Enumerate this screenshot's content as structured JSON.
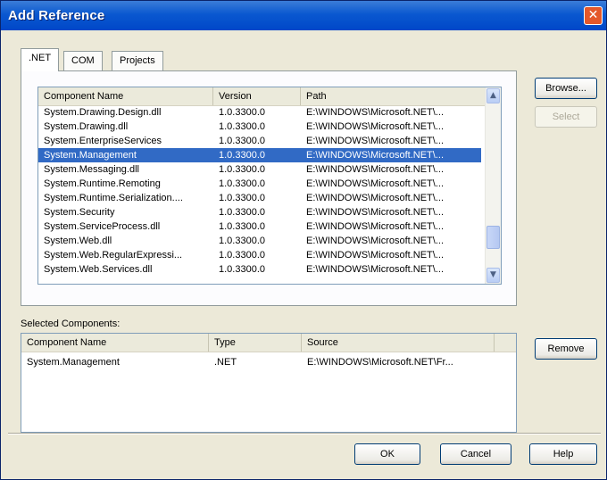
{
  "window": {
    "title": "Add Reference"
  },
  "tabs": [
    ".NET",
    "COM",
    "Projects"
  ],
  "components": {
    "columns": [
      "Component Name",
      "Version",
      "Path"
    ],
    "rows": [
      {
        "name": "System.Drawing.Design.dll",
        "version": "1.0.3300.0",
        "path": "E:\\WINDOWS\\Microsoft.NET\\..."
      },
      {
        "name": "System.Drawing.dll",
        "version": "1.0.3300.0",
        "path": "E:\\WINDOWS\\Microsoft.NET\\..."
      },
      {
        "name": "System.EnterpriseServices",
        "version": "1.0.3300.0",
        "path": "E:\\WINDOWS\\Microsoft.NET\\..."
      },
      {
        "name": "System.Management",
        "version": "1.0.3300.0",
        "path": "E:\\WINDOWS\\Microsoft.NET\\...",
        "selected": true
      },
      {
        "name": "System.Messaging.dll",
        "version": "1.0.3300.0",
        "path": "E:\\WINDOWS\\Microsoft.NET\\..."
      },
      {
        "name": "System.Runtime.Remoting",
        "version": "1.0.3300.0",
        "path": "E:\\WINDOWS\\Microsoft.NET\\..."
      },
      {
        "name": "System.Runtime.Serialization....",
        "version": "1.0.3300.0",
        "path": "E:\\WINDOWS\\Microsoft.NET\\..."
      },
      {
        "name": "System.Security",
        "version": "1.0.3300.0",
        "path": "E:\\WINDOWS\\Microsoft.NET\\..."
      },
      {
        "name": "System.ServiceProcess.dll",
        "version": "1.0.3300.0",
        "path": "E:\\WINDOWS\\Microsoft.NET\\..."
      },
      {
        "name": "System.Web.dll",
        "version": "1.0.3300.0",
        "path": "E:\\WINDOWS\\Microsoft.NET\\..."
      },
      {
        "name": "System.Web.RegularExpressi...",
        "version": "1.0.3300.0",
        "path": "E:\\WINDOWS\\Microsoft.NET\\..."
      },
      {
        "name": "System.Web.Services.dll",
        "version": "1.0.3300.0",
        "path": "E:\\WINDOWS\\Microsoft.NET\\..."
      }
    ]
  },
  "selected_label": "Selected Components:",
  "selected": {
    "columns": [
      "Component Name",
      "Type",
      "Source"
    ],
    "rows": [
      {
        "name": "System.Management",
        "type": ".NET",
        "source": "E:\\WINDOWS\\Microsoft.NET\\Fr..."
      }
    ]
  },
  "buttons": {
    "browse": "Browse...",
    "select": "Select",
    "remove": "Remove",
    "ok": "OK",
    "cancel": "Cancel",
    "help": "Help"
  },
  "colors": {
    "titlebar": "#0047c8",
    "selection": "#316ac5",
    "close": "#e4582b"
  }
}
